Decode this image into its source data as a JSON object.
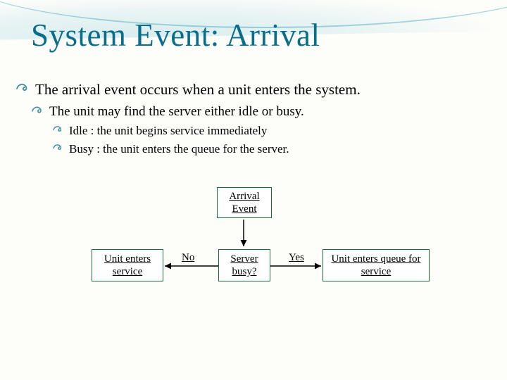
{
  "title": "System Event: Arrival",
  "bullets": {
    "l1": "The arrival event occurs when a unit enters the system.",
    "l2": "The unit may find the server either idle or busy.",
    "l3a": "Idle : the unit begins service immediately",
    "l3b": "Busy : the unit enters the queue for the server."
  },
  "diagram": {
    "top_box": "Arrival Event",
    "decision": "Server busy?",
    "left_box": "Unit enters service",
    "right_box": "Unit enters queue for service",
    "no_label": "No",
    "yes_label": "Yes"
  }
}
